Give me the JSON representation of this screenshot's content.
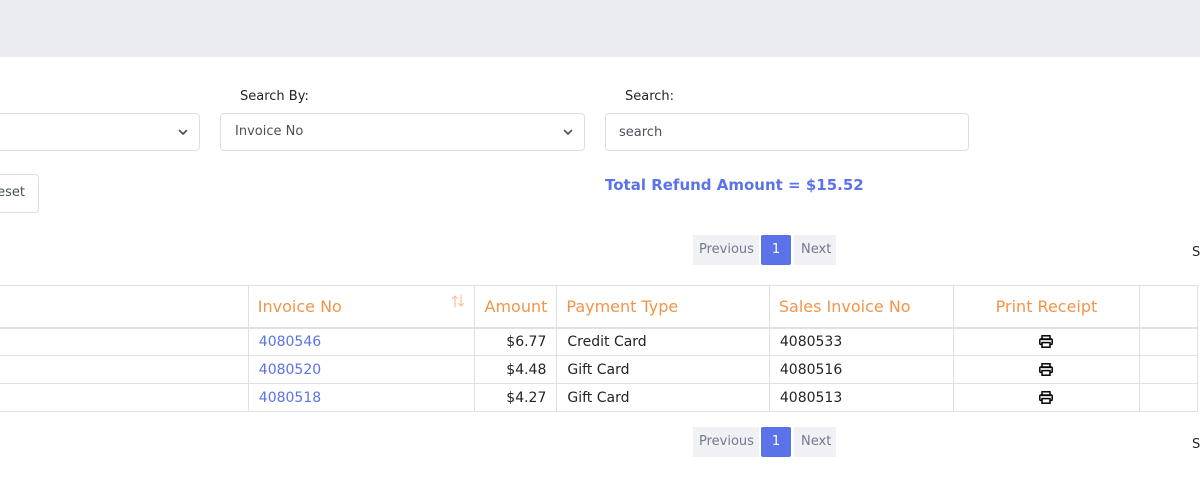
{
  "filters": {
    "first_select_value": "",
    "search_by_label": "Search By:",
    "search_by_value": "Invoice No",
    "search_label": "Search:",
    "search_placeholder": "search",
    "search_value": "",
    "reset_label": "Reset"
  },
  "summary": {
    "total_refund": "Total Refund Amount = $15.52"
  },
  "pagination": {
    "previous_label": "Previous",
    "current_page": "1",
    "next_label": "Next",
    "right_edge_text": "S"
  },
  "table": {
    "columns": {
      "col0": "",
      "invoice_no": "Invoice No",
      "amount": "Amount",
      "payment_type": "Payment Type",
      "sales_invoice_no": "Sales Invoice No",
      "print_receipt": "Print Receipt",
      "col6": ""
    },
    "rows": [
      {
        "invoice_no": "4080546",
        "amount": "$6.77",
        "payment_type": "Credit Card",
        "sales_invoice_no": "4080533"
      },
      {
        "invoice_no": "4080520",
        "amount": "$4.48",
        "payment_type": "Gift Card",
        "sales_invoice_no": "4080516"
      },
      {
        "invoice_no": "4080518",
        "amount": "$4.27",
        "payment_type": "Gift Card",
        "sales_invoice_no": "4080513"
      }
    ]
  },
  "icons": {
    "sort": "sort-arrows-icon",
    "print": "printer-icon",
    "chevron": "chevron-down-icon"
  },
  "colors": {
    "accent": "#5b73e8",
    "header_text": "#f1954a",
    "topbar": "#ebecf1"
  }
}
